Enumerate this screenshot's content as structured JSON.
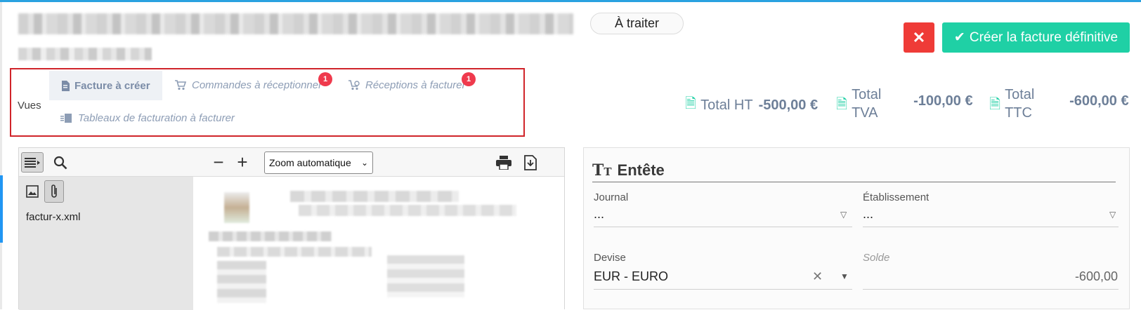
{
  "header": {
    "status": "À traiter",
    "cancel_symbol": "✕",
    "create_label": "Créer la facture définitive"
  },
  "views": {
    "label": "Vues",
    "tabs": [
      {
        "label": "Facture à créer",
        "icon": "document-icon",
        "badge": null
      },
      {
        "label": "Commandes à réceptionner",
        "icon": "truck-icon",
        "badge": "1"
      },
      {
        "label": "Réceptions à facturer",
        "icon": "cart-icon",
        "badge": "1"
      },
      {
        "label": "Tableaux de facturation à facturer",
        "icon": "table-invoice-icon",
        "badge": null
      }
    ]
  },
  "totals": [
    {
      "label": "Total HT",
      "value": "-500,00 €"
    },
    {
      "label": "Total TVA",
      "value": "-100,00 €"
    },
    {
      "label": "Total TTC",
      "value": "-600,00 €"
    }
  ],
  "viewer": {
    "zoom": "Zoom automatique",
    "attachment": "factur-x.xml"
  },
  "form": {
    "title": "Entête",
    "journal_label": "Journal",
    "journal_value": "...",
    "etablissement_label": "Établissement",
    "etablissement_value": "...",
    "devise_label": "Devise",
    "devise_value": "EUR - EURO",
    "solde_label": "Solde",
    "solde_value": "-600,00"
  },
  "colors": {
    "accent": "#1fd0a5",
    "danger": "#ef3b37",
    "highlight_border": "#d0242a",
    "badge": "#ef3a4d"
  }
}
